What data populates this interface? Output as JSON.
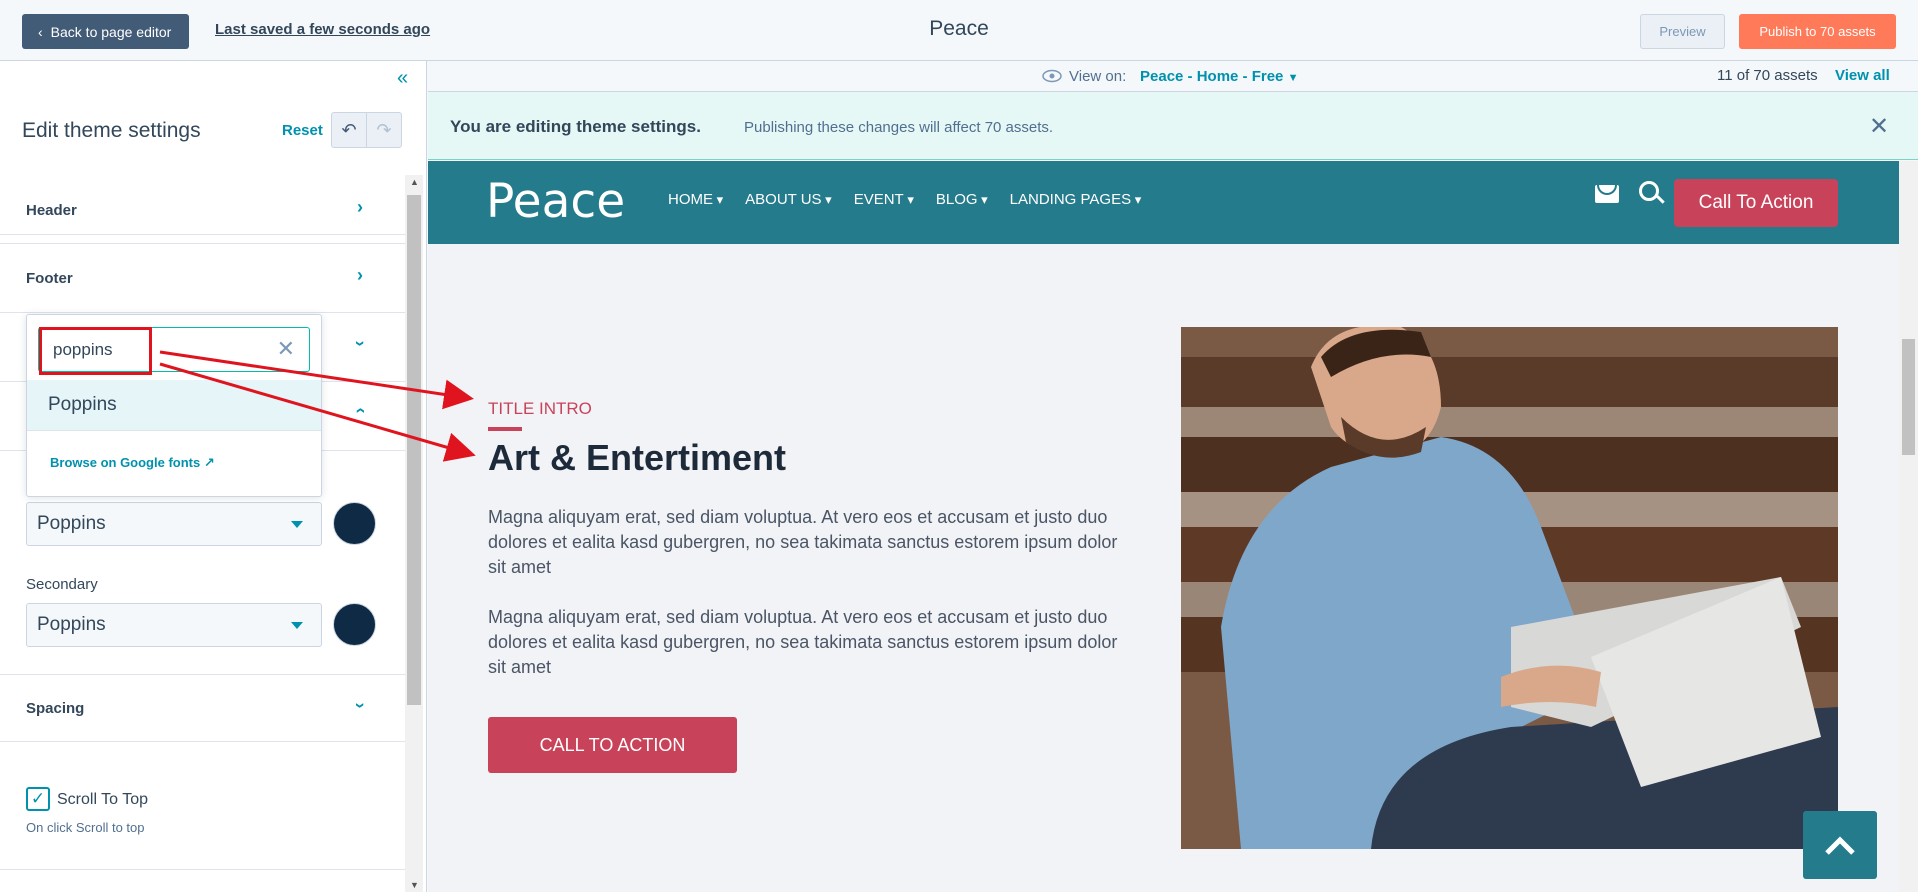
{
  "topbar": {
    "back_label": "Back to page editor",
    "saved_text": "Last saved a few seconds ago",
    "title": "Peace",
    "preview_label": "Preview",
    "publish_label": "Publish to 70 assets"
  },
  "sidebar": {
    "title": "Edit theme settings",
    "reset_label": "Reset",
    "sections": {
      "header": "Header",
      "footer": "Footer",
      "spacing": "Spacing"
    },
    "font_dropdown": {
      "search_value": "poppins",
      "option": "Poppins",
      "browse_label": "Browse on Google fonts"
    },
    "primary_font": "Poppins",
    "secondary_label": "Secondary",
    "secondary_font": "Poppins",
    "swatch_color": "#0f2a44",
    "scroll_to_top_label": "Scroll To Top",
    "scroll_to_top_help": "On click Scroll to top",
    "scroll_to_top_checked": true
  },
  "viewbar": {
    "view_on_label": "View on:",
    "view_page": "Peace - Home - Free",
    "assets_count": "11 of 70 assets",
    "view_all": "View all"
  },
  "banner": {
    "strong": "You are editing theme settings.",
    "text": "Publishing these changes will affect 70 assets."
  },
  "site": {
    "logo": "Peace",
    "nav": [
      "HOME",
      "ABOUT US",
      "EVENT",
      "BLOG",
      "LANDING PAGES"
    ],
    "header_cta": "Call To Action",
    "title_intro": "TITLE INTRO",
    "heading": "Art & Entertiment",
    "paragraph_1": "Magna aliquyam erat, sed diam voluptua. At vero eos et accusam et justo duo dolores et ealita kasd gubergren, no sea takimata sanctus estorem ipsum dolor sit amet",
    "paragraph_2": "Magna aliquyam erat, sed diam voluptua. At vero eos et accusam et justo duo dolores et ealita kasd gubergren, no sea takimata sanctus estorem ipsum dolor sit amet",
    "cta_label": "CALL TO ACTION"
  },
  "colors": {
    "brand_teal": "#247b8c",
    "accent_red": "#c8435a",
    "publish_orange": "#ff7a59",
    "annotation_red": "#e0141e"
  },
  "icons": [
    "chevron-left-icon",
    "double-chevron-left-icon",
    "undo-icon",
    "redo-icon",
    "chevron-right-icon",
    "chevron-down-icon",
    "close-icon",
    "external-link-icon",
    "eye-icon",
    "mail-icon",
    "search-icon",
    "arrow-up-icon",
    "check-icon"
  ]
}
